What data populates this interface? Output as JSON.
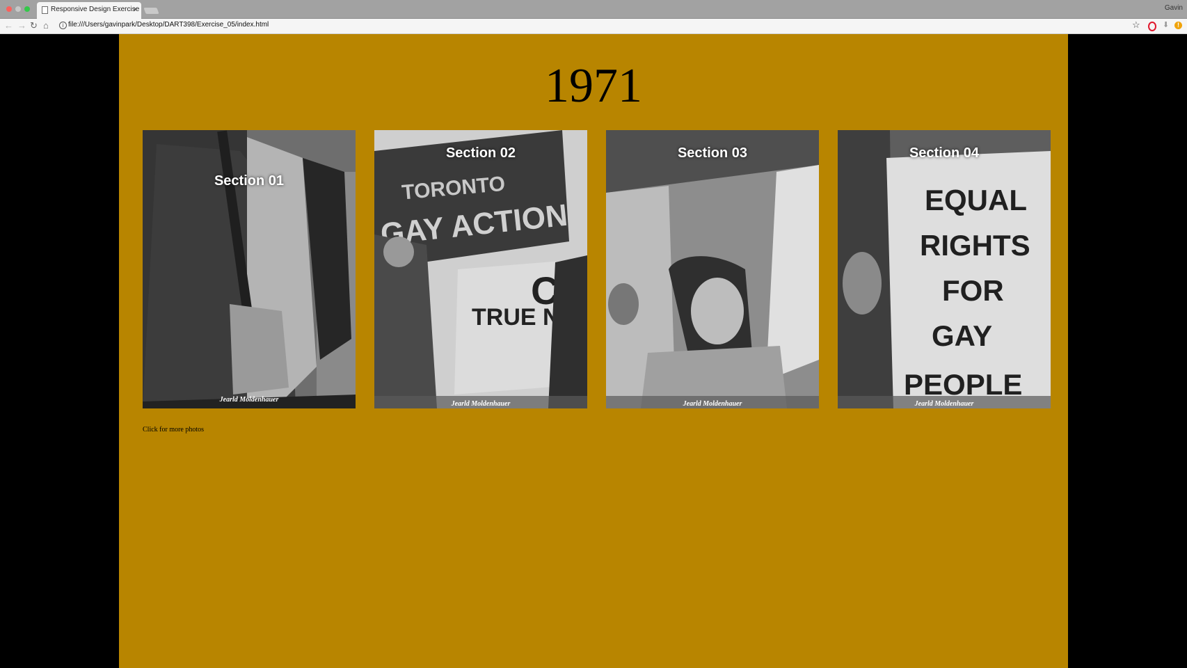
{
  "browser": {
    "tab_title": "Responsive Design Exercise",
    "tab_close": "×",
    "profile_name": "Gavin",
    "url": "file:///Users/gavinpark/Desktop/DART398/Exercise_05/index.html",
    "icons": {
      "back": "←",
      "forward": "→",
      "reload": "↻",
      "home": "⌂",
      "info": "i",
      "star": "☆",
      "alert": "!"
    }
  },
  "page": {
    "background": "#b88500",
    "side_color": "#000000",
    "heading": "1971",
    "cards": [
      {
        "title": "Section 01",
        "credit": "Jearld Moldenhauer"
      },
      {
        "title": "Section 02",
        "credit": "Jearld Moldenhauer"
      },
      {
        "title": "Section 03",
        "credit": "Jearld Moldenhauer"
      },
      {
        "title": "Section 04",
        "credit": "Jearld Moldenhauer"
      }
    ],
    "more_link": "Click for more photos"
  }
}
